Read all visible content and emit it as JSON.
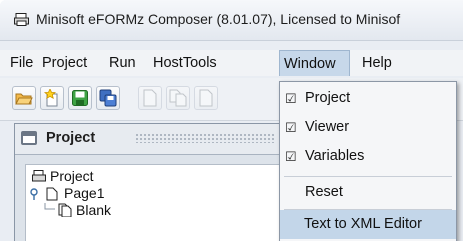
{
  "window": {
    "title": "Minisoft eFORMz Composer (8.01.07), Licensed to Minisof"
  },
  "menubar": {
    "items": [
      "File",
      "Project",
      "Run",
      "HostTools",
      "Window",
      "Help"
    ],
    "active": "Window"
  },
  "toolbar": {
    "buttons": [
      "open-folder-icon",
      "new-star-icon",
      "save-icon",
      "save-all-icon",
      "page-icon",
      "copy-page-icon",
      "page-icon"
    ]
  },
  "panel": {
    "title": "Project"
  },
  "tree": {
    "root": "Project",
    "child": "Page1",
    "grandchild": "Blank"
  },
  "window_menu": {
    "items": [
      {
        "label": "Project",
        "checked": true
      },
      {
        "label": "Viewer",
        "checked": true
      },
      {
        "label": "Variables",
        "checked": true
      },
      {
        "label": "Reset",
        "checked": false
      },
      {
        "label": "Text to XML Editor",
        "checked": false,
        "highlighted": true
      }
    ],
    "check_glyph": "☑"
  },
  "colors": {
    "menu_highlight": "#c3d6e9",
    "active_menu": "#c7d8ea",
    "background": "#e9edf3"
  }
}
